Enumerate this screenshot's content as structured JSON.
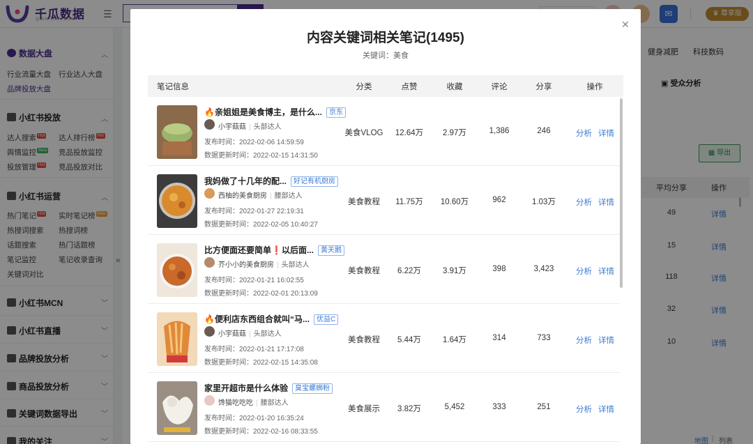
{
  "app": {
    "logo_text": "千瓜数据",
    "logo_sub": "QIAN-GUA.COM",
    "vip_label": "尊享版"
  },
  "sidebar": {
    "sections": [
      {
        "label": "数据大盘",
        "active": true,
        "items": [
          "行业流量大盘",
          "行业达人大盘",
          "品牌投放大盘"
        ]
      },
      {
        "label": "小红书投放",
        "items": [
          "达人搜索",
          "达人排行榜",
          "舆情监控",
          "竞品投放监控",
          "投放管理",
          "竞品投放对比"
        ]
      },
      {
        "label": "小红书运营",
        "items": [
          "热门笔记",
          "实时笔记榜",
          "热搜词搜索",
          "热搜词榜",
          "话题搜索",
          "热门话题榜",
          "笔记监控",
          "笔记收录查询",
          "关键词对比"
        ]
      },
      {
        "label": "小红书MCN"
      },
      {
        "label": "小红书直播"
      },
      {
        "label": "品牌投放分析"
      },
      {
        "label": "商品投放分析"
      },
      {
        "label": "关键词数据导出"
      },
      {
        "label": "我的关注"
      }
    ],
    "badges": {
      "hot": "Hot",
      "beta": "Beta",
      "new": "New"
    }
  },
  "background": {
    "tabs": [
      "健身减肥",
      "科技数码"
    ],
    "audience_btn": "受众分析",
    "export_btn": "导出",
    "col_share": "平均分享",
    "col_action": "操作",
    "rows": [
      {
        "share": "49",
        "action": "详情"
      },
      {
        "share": "15",
        "action": "详情"
      },
      {
        "share": "118",
        "action": "详情"
      },
      {
        "share": "32",
        "action": "详情"
      },
      {
        "share": "10",
        "action": "详情"
      }
    ],
    "footer": {
      "map": "地图",
      "list": "列表"
    }
  },
  "modal": {
    "title": "内容关键词相关笔记(1495)",
    "keyword_label": "关键词：美食",
    "columns": {
      "info": "笔记信息",
      "category": "分类",
      "likes": "点赞",
      "collects": "收藏",
      "comments": "评论",
      "shares": "分享",
      "ops": "操作"
    },
    "publish_prefix": "发布时间：",
    "update_prefix": "数据更新时间：",
    "analyze": "分析",
    "detail": "详情",
    "rows": [
      {
        "title": "🔥亲姐姐是美食博主，是什么...",
        "tag": "京东",
        "author": "小宇菇菇",
        "level": "头部达人",
        "published": "2022-02-06 14:59:59",
        "updated": "2022-02-15 14:31:50",
        "category": "美食VLOG",
        "likes": "12.64万",
        "collects": "2.97万",
        "comments": "1,386",
        "shares": "246"
      },
      {
        "title": "我妈做了十几年的配...",
        "tag": "好记有机厨房",
        "author": "西柚的美食厨房",
        "level": "腰部达人",
        "published": "2022-01-27 22:19:31",
        "updated": "2022-02-05 10:40:27",
        "category": "美食教程",
        "likes": "11.75万",
        "collects": "10.60万",
        "comments": "962",
        "shares": "1.03万"
      },
      {
        "title": "比方便面还要简单❗以后面...",
        "tag": "黄天鹅",
        "author": "芥小小的美食厨房",
        "level": "头部达人",
        "published": "2022-01-21 16:02:55",
        "updated": "2022-02-01 20:13:09",
        "category": "美食教程",
        "likes": "6.22万",
        "collects": "3.91万",
        "comments": "398",
        "shares": "3,423"
      },
      {
        "title": "🔥便利店东西组合就叫“马...",
        "tag": "优益C",
        "author": "小宇菇菇",
        "level": "头部达人",
        "published": "2022-01-21 17:17:08",
        "updated": "2022-02-15 14:35:08",
        "category": "美食教程",
        "likes": "5.44万",
        "collects": "1.64万",
        "comments": "314",
        "shares": "733"
      },
      {
        "title": "家里开超市是什么体验",
        "tag": "臭宝螺蛳粉",
        "author": "馋猫吃吃吃",
        "level": "腰部达人",
        "published": "2022-01-20 16:35:24",
        "updated": "2022-02-16 08:33:55",
        "category": "美食展示",
        "likes": "3.82万",
        "collects": "5,452",
        "comments": "333",
        "shares": "251"
      }
    ]
  }
}
